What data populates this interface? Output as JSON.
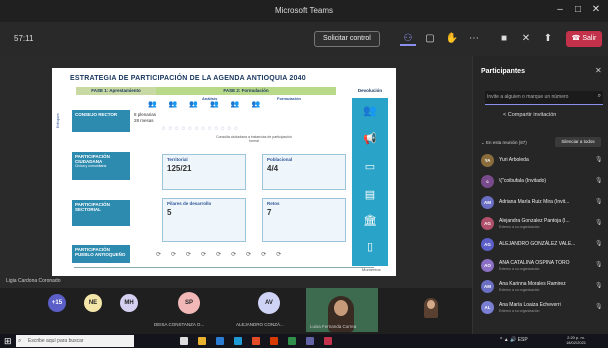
{
  "window": {
    "title": "Microsoft Teams"
  },
  "toolbar": {
    "timer": "57:11",
    "request_control_label": "Solicitar control",
    "leave_label": "Salir",
    "leave_color": "#c4314b",
    "icons": [
      "participants-icon",
      "chat-icon",
      "reactions-icon",
      "more-icon",
      "camera-icon",
      "mic-icon",
      "share-icon",
      "phone-icon"
    ]
  },
  "slide": {
    "title": "ESTRATEGIA DE PARTICIPACIÓN DE LA AGENDA ANTIOQUIA 2040",
    "phase1": "FASE 1: Aprestamiento",
    "phase2": "FASE 2: Formulación",
    "devolucion": "Devolución",
    "sub_analisis": "Análisis",
    "sub_formulacion": "Formulación",
    "side_label": "Enfoques",
    "rows": [
      {
        "label": "CONSEJO RECTOR",
        "sub": ""
      },
      {
        "label": "PARTICIPACIÓN CIUDADANA",
        "sub": "Civica y comunitaria"
      },
      {
        "label": "PARTICIPACIÓN SECTORIAL",
        "sub": ""
      },
      {
        "label": "PARTICIPACIÓN PUEBLO ANTIOQUEÑO",
        "sub": ""
      }
    ],
    "rector_note_1": "8 plenarias",
    "rector_note_2": "28 mesas",
    "consult_note": "Consulta ciudadana a instancias de participación formal",
    "territorial_label": "Territorial",
    "territorial_value": "125/21",
    "poblacional_label": "Poblacional",
    "poblacional_value": "4/4",
    "pilares_label": "Pilares de desarrollo",
    "pilares_value": "5",
    "retos_label": "Retos",
    "retos_value": "7",
    "momentos_label": "Momentos"
  },
  "stage": {
    "presenter_name": "Ligia Cardona Coronado"
  },
  "strip": {
    "more_count": "+15",
    "avatars": [
      {
        "initials": "NE"
      },
      {
        "initials": "MH"
      },
      {
        "initials": "SP",
        "name": "DEISA CONSTANZA O..."
      },
      {
        "initials": "AV",
        "name": "ALEJANDRO CONZÁ..."
      }
    ],
    "video_name": "Luisa Fernanda Correa"
  },
  "panel": {
    "title": "Participantes",
    "search_placeholder": "Invite a alguien o marque un número",
    "share_invite": "Compartir invitación",
    "in_meeting": "En esta reunión (87)",
    "mute_all": "Silenciar a todos",
    "participants": [
      {
        "initials": "YA",
        "name": "Yuri Arboleda",
        "sub": "",
        "color": "#8a6d3b"
      },
      {
        "initials": "c",
        "name": "\\(\"coibufala (Invitado)",
        "sub": "",
        "color": "#7a4b8c"
      },
      {
        "initials": "AM",
        "name": "Adriana María Ruiz Mira (Invit...",
        "sub": "",
        "color": "#6a6fc4"
      },
      {
        "initials": "AG",
        "name": "Alejandra Gonzalez Pantoja (I...",
        "sub": "Externo a su organización",
        "color": "#b0506b"
      },
      {
        "initials": "AG",
        "name": "ALEJANDRO GONZÁLEZ VALE...",
        "sub": "",
        "color": "#5b5fc7"
      },
      {
        "initials": "AO",
        "name": "ANA CATALINA OSPINA TORO",
        "sub": "Externo a su organización",
        "color": "#8b6fc4"
      },
      {
        "initials": "AM",
        "name": "Ana Karinna Morales Ramirez",
        "sub": "Externo a su organización",
        "color": "#6a6fc4"
      },
      {
        "initials": "AL",
        "name": "Ana María Loaiza Echeverri",
        "sub": "Externo a su organización",
        "color": "#7a7fd4"
      }
    ]
  },
  "taskbar": {
    "search_placeholder": "Escribe aquí para buscar",
    "language": "ESP",
    "time": "2:20 p. m.",
    "date": "18/02/2021"
  }
}
